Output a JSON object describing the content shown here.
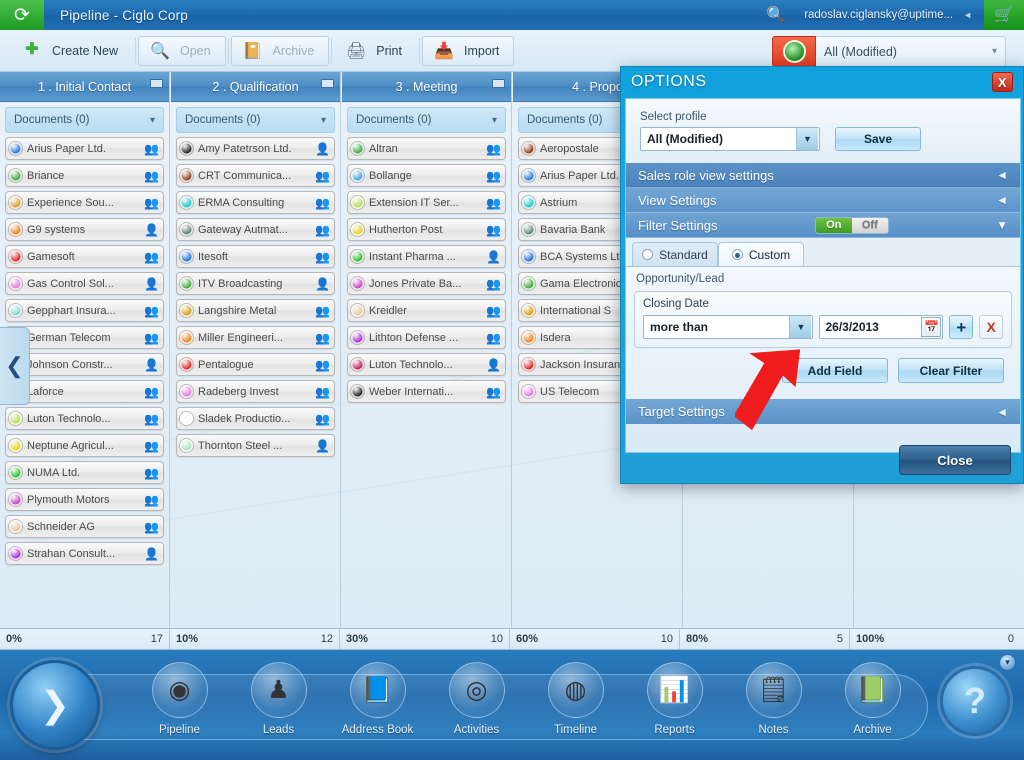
{
  "titlebar": {
    "logo_icon": "refresh-icon",
    "title": "Pipeline - Ciglo Corp",
    "search_icon": "search-icon",
    "user": "radoslav.ciglansky@uptime...",
    "user_caret": "◄",
    "cart_icon": "basket-icon"
  },
  "toolbar": {
    "buttons": [
      {
        "label": "Create New",
        "icon": "plus-icon",
        "disabled": false
      },
      {
        "label": "Open",
        "icon": "magnifier-icon",
        "disabled": true
      },
      {
        "label": "Archive",
        "icon": "archive-icon",
        "disabled": true
      },
      {
        "label": "Print",
        "icon": "printer-icon",
        "disabled": false
      },
      {
        "label": "Import",
        "icon": "import-icon",
        "disabled": false
      }
    ],
    "profile_filter": {
      "gear_icon": "gear-icon",
      "value": "All (Modified)",
      "caret": "⌄"
    }
  },
  "board": {
    "collapse_left_icon": "chevron-left-icon",
    "columns": [
      {
        "title": "1 . Initial Contact",
        "documents": "Documents (0)",
        "percent": "0%",
        "count": "17",
        "cards": [
          {
            "name": "Arius Paper Ltd.",
            "color": "#2277d8",
            "people": "group"
          },
          {
            "name": "Briance",
            "color": "#3aa93a",
            "people": "group"
          },
          {
            "name": "Experience Sou...",
            "color": "#d79b15",
            "people": "group"
          },
          {
            "name": "G9 systems",
            "color": "#e8811a",
            "people": "single"
          },
          {
            "name": "Gamesoft",
            "color": "#dc2020",
            "people": "group"
          },
          {
            "name": "Gas Control Sol...",
            "color": "#e07ae0",
            "people": "single"
          },
          {
            "name": "Gepphart Insura...",
            "color": "#7fd6cf",
            "people": "group"
          },
          {
            "name": "German Telecom",
            "color": "#a9ddef",
            "people": "group"
          },
          {
            "name": "Johnson Constr...",
            "color": "#66c98b",
            "people": "single"
          },
          {
            "name": "Laforce",
            "color": "#57bde8",
            "people": "group"
          },
          {
            "name": "Luton Technolo...",
            "color": "#b4e04a",
            "people": "group"
          },
          {
            "name": "Neptune Agricul...",
            "color": "#e8d21a",
            "people": "group"
          },
          {
            "name": "NUMA Ltd.",
            "color": "#25c025",
            "people": "group"
          },
          {
            "name": "Plymouth Motors",
            "color": "#c43fc4",
            "people": "group"
          },
          {
            "name": "Schneider AG",
            "color": "#e4c79a",
            "people": "group"
          },
          {
            "name": "Strahan Consult...",
            "color": "#a726e0",
            "people": "single"
          }
        ]
      },
      {
        "title": "2 . Qualification",
        "documents": "Documents (0)",
        "percent": "10%",
        "count": "12",
        "cards": [
          {
            "name": "Amy Patetrson Ltd.",
            "color": "#1d1d1d",
            "people": "single"
          },
          {
            "name": "CRT Communica...",
            "color": "#8c3a18",
            "people": "group"
          },
          {
            "name": "ERMA Consulting",
            "color": "#16c7c7",
            "people": "group"
          },
          {
            "name": "Gateway Autmat...",
            "color": "#5e7d74",
            "people": "group"
          },
          {
            "name": "Itesoft",
            "color": "#1d6fd4",
            "people": "group"
          },
          {
            "name": "ITV Broadcasting",
            "color": "#3aa93a",
            "people": "single"
          },
          {
            "name": "Langshire Metal",
            "color": "#d79b15",
            "people": "group"
          },
          {
            "name": "Miller Engineeri...",
            "color": "#e8811a",
            "people": "group"
          },
          {
            "name": "Pentalogue",
            "color": "#dc2020",
            "people": "group"
          },
          {
            "name": "Radeberg Invest",
            "color": "#e07ae0",
            "people": "group"
          },
          {
            "name": "Sladek Productio...",
            "color": "#fdfdfd",
            "people": "group"
          },
          {
            "name": "Thornton Steel ...",
            "color": "#a9e4c4",
            "people": "single"
          }
        ]
      },
      {
        "title": "3 . Meeting",
        "documents": "Documents (0)",
        "percent": "30%",
        "count": "10",
        "cards": [
          {
            "name": "Altran",
            "color": "#3aa93a",
            "people": "group"
          },
          {
            "name": "Bollange",
            "color": "#3fa4e0",
            "people": "group"
          },
          {
            "name": "Extension IT Ser...",
            "color": "#b4e04a",
            "people": "group"
          },
          {
            "name": "Hutherton Post",
            "color": "#e8d21a",
            "people": "group"
          },
          {
            "name": "Instant Pharma ...",
            "color": "#25c025",
            "people": "single"
          },
          {
            "name": "Jones Private Ba...",
            "color": "#c43fc4",
            "people": "group"
          },
          {
            "name": "Kreidler",
            "color": "#e4c79a",
            "people": "group"
          },
          {
            "name": "Lithton Defense ...",
            "color": "#a726e0",
            "people": "group"
          },
          {
            "name": "Luton Technolo...",
            "color": "#c4145c",
            "people": "single"
          },
          {
            "name": "Weber Internati...",
            "color": "#1d1d1d",
            "people": "group"
          }
        ]
      },
      {
        "title": "4 . Propo",
        "documents": "Documents (0)",
        "percent": "60%",
        "count": "10",
        "cards": [
          {
            "name": "Aeropostale",
            "color": "#8c3a18",
            "people": "none"
          },
          {
            "name": "Arius Paper Ltd.",
            "color": "#2277d8",
            "people": "none"
          },
          {
            "name": "Astrium",
            "color": "#16c7c7",
            "people": "none"
          },
          {
            "name": "Bavaria Bank",
            "color": "#5e7d74",
            "people": "none"
          },
          {
            "name": "BCA Systems Ltd",
            "color": "#1d6fd4",
            "people": "none"
          },
          {
            "name": "Gama Electronic",
            "color": "#3aa93a",
            "people": "none"
          },
          {
            "name": "International S",
            "color": "#d79b15",
            "people": "none"
          },
          {
            "name": "Isdera",
            "color": "#e8811a",
            "people": "none"
          },
          {
            "name": "Jackson Insuran",
            "color": "#dc2020",
            "people": "none"
          },
          {
            "name": "US Telecom",
            "color": "#e07ae0",
            "people": "none"
          }
        ]
      },
      {
        "title": "",
        "documents": "",
        "percent": "80%",
        "count": "5",
        "cards": []
      },
      {
        "title": "",
        "documents": "",
        "percent": "100%",
        "count": "0",
        "cards": []
      }
    ]
  },
  "options_dialog": {
    "title": "OPTIONS",
    "close_icon": "X",
    "select_profile_label": "Select profile",
    "profile_value": "All (Modified)",
    "profile_caret": "▼",
    "save_label": "Save",
    "accordions": [
      {
        "label": "Sales role view settings",
        "caret": "◄",
        "state": "collapsed"
      },
      {
        "label": "View Settings",
        "caret": "◄",
        "state": "collapsed"
      },
      {
        "label": "Filter Settings",
        "caret": "▼",
        "state": "expanded",
        "toggle_on": "On",
        "toggle_off": "Off",
        "toggle_value": "On"
      },
      {
        "label": "Target Settings",
        "caret": "◄",
        "state": "collapsed"
      }
    ],
    "filter": {
      "tab_standard": "Standard",
      "tab_custom": "Custom",
      "active_tab": "Custom",
      "section_label": "Opportunity/Lead",
      "field_label": "Closing Date",
      "operator_value": "more than",
      "operator_caret": "▼",
      "date_value": "26/3/2013",
      "calendar_icon": "calendar-icon",
      "add_row_icon": "+",
      "remove_row_icon": "X",
      "add_field_label": "Add Field",
      "clear_filter_label": "Clear Filter"
    },
    "close_label": "Close"
  },
  "dock": {
    "home_icon": "app-home-icon",
    "help_icon": "?",
    "chevron_icon": "⌄",
    "items": [
      {
        "label": "Pipeline",
        "icon": "pipeline-icon",
        "glyph": "◉"
      },
      {
        "label": "Leads",
        "icon": "leads-icon",
        "glyph": "♟"
      },
      {
        "label": "Address Book",
        "icon": "address-book-icon",
        "glyph": "📘"
      },
      {
        "label": "Activities",
        "icon": "activities-icon",
        "glyph": "◎"
      },
      {
        "label": "Timeline",
        "icon": "timeline-icon",
        "glyph": "◍"
      },
      {
        "label": "Reports",
        "icon": "reports-icon",
        "glyph": "📊"
      },
      {
        "label": "Notes",
        "icon": "notes-icon",
        "glyph": "🗒"
      },
      {
        "label": "Archive",
        "icon": "archive-book-icon",
        "glyph": "📗"
      }
    ]
  },
  "annotation": {
    "arrow_color": "#ee1c1c",
    "points_to": "Add Field"
  }
}
